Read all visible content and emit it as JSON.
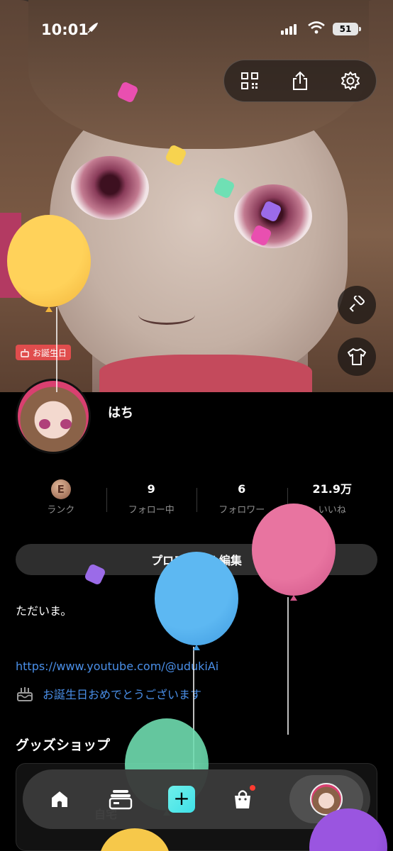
{
  "status_bar": {
    "time": "10:01",
    "battery": "51"
  },
  "hero": {
    "birthday_tag": "お誕生日"
  },
  "profile": {
    "username": "はち"
  },
  "stats": [
    {
      "value": "",
      "label": "ランク",
      "rank_letter": "E"
    },
    {
      "value": "9",
      "label": "フォロー中"
    },
    {
      "value": "6",
      "label": "フォロワー"
    },
    {
      "value": "21.9万",
      "label": "いいね"
    }
  ],
  "edit_profile_label": "プロフィール編集",
  "bio": "ただいま。",
  "link": "https://www.youtube.com/@udukiAi",
  "birthday_message": "お誕生日おめでとうございます",
  "goods": {
    "title": "グッズショップ",
    "banner_text": "自宅"
  },
  "colors": {
    "accent": "#4a8fe8",
    "birthday": "#e04d4d",
    "plus": "#4fe6ea",
    "notify": "#ff3b30"
  },
  "icons": [
    "rocket-icon",
    "qr-code-icon",
    "share-icon",
    "gear-icon",
    "paint-roller-icon",
    "shirt-icon",
    "cake-icon",
    "home-icon",
    "inbox-icon",
    "plus-icon",
    "shopping-bag-icon"
  ]
}
